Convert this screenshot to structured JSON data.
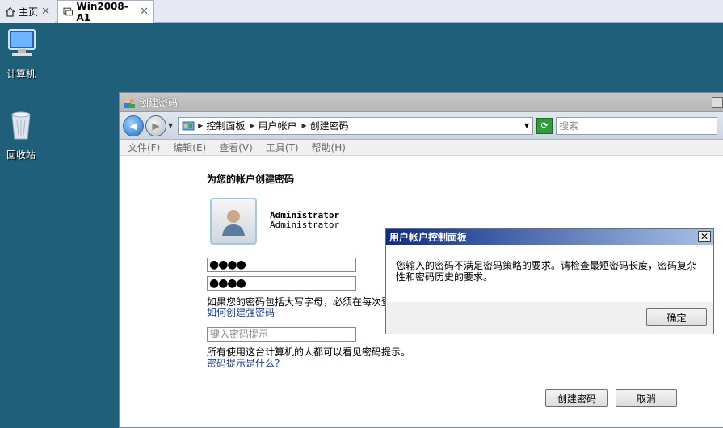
{
  "tabs": {
    "home_label": "主页",
    "vm_label": "Win2008-A1",
    "close_glyph": "✕"
  },
  "desktop": {
    "computer_label": "计算机",
    "recycle_label": "回收站"
  },
  "window": {
    "title": "创建密码",
    "breadcrumb": [
      "控制面板",
      "用户帐户",
      "创建密码"
    ],
    "search_placeholder": "搜索",
    "menu": [
      "文件(F)",
      "编辑(E)",
      "查看(V)",
      "工具(T)",
      "帮助(H)"
    ]
  },
  "form": {
    "heading": "为您的帐户创建密码",
    "username_bold": "Administrator",
    "username_sub": "Administrator",
    "password_mask": "●●●●",
    "confirm_mask": "●●●●",
    "note": "如果您的密码包括大写字母，必须在每次登",
    "strong_link": "如何创建强密码",
    "hint_placeholder": "键入密码提示",
    "hint_note": "所有使用这台计算机的人都可以看见密码提示。",
    "hint_link": "密码提示是什么?",
    "create_button": "创建密码",
    "cancel_button": "取消"
  },
  "dialog": {
    "title": "用户帐户控制面板",
    "message": "您输入的密码不满足密码策略的要求。请检查最短密码长度，密码复杂性和密码历史的要求。",
    "ok_button": "确定"
  }
}
